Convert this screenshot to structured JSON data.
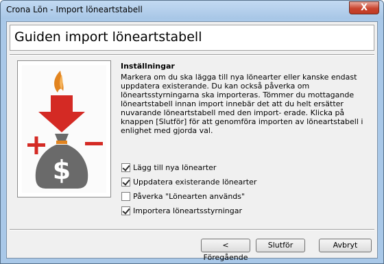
{
  "window": {
    "title": "Crona Lön - Import löneartstabell",
    "close_label": "X"
  },
  "header": {
    "title": "Guiden import löneartstabell"
  },
  "content": {
    "section_title": "Inställningar",
    "description": "Markera om du ska lägga till nya lönearter eller kanske endast uppdatera existerande. Du kan också påverka om löneartsstyrningarna ska importeras. Tömmer du mottagande löneartstabell innan import innebär det att du helt ersätter nuvarande löneartstabell med den import- erade. Klicka på knappen [Slutför] för att genomföra importen av löneartstabell i enlighet med gjorda val."
  },
  "options": [
    {
      "label": "Lägg till nya lönearter",
      "checked": true
    },
    {
      "label": "Uppdatera existerande lönearter",
      "checked": true
    },
    {
      "label": "Påverka \"Lönearten används\"",
      "checked": false
    },
    {
      "label": "Importera löneartsstyrningar",
      "checked": true
    }
  ],
  "buttons": {
    "back": "< Föregående",
    "finish": "Slutför",
    "cancel": "Avbryt"
  },
  "colors": {
    "arrow_red": "#d42a24",
    "flame_orange": "#e2841f",
    "bag_gray": "#6a6a6a"
  },
  "icons": {
    "illustration": "import-moneybag-illustration"
  }
}
